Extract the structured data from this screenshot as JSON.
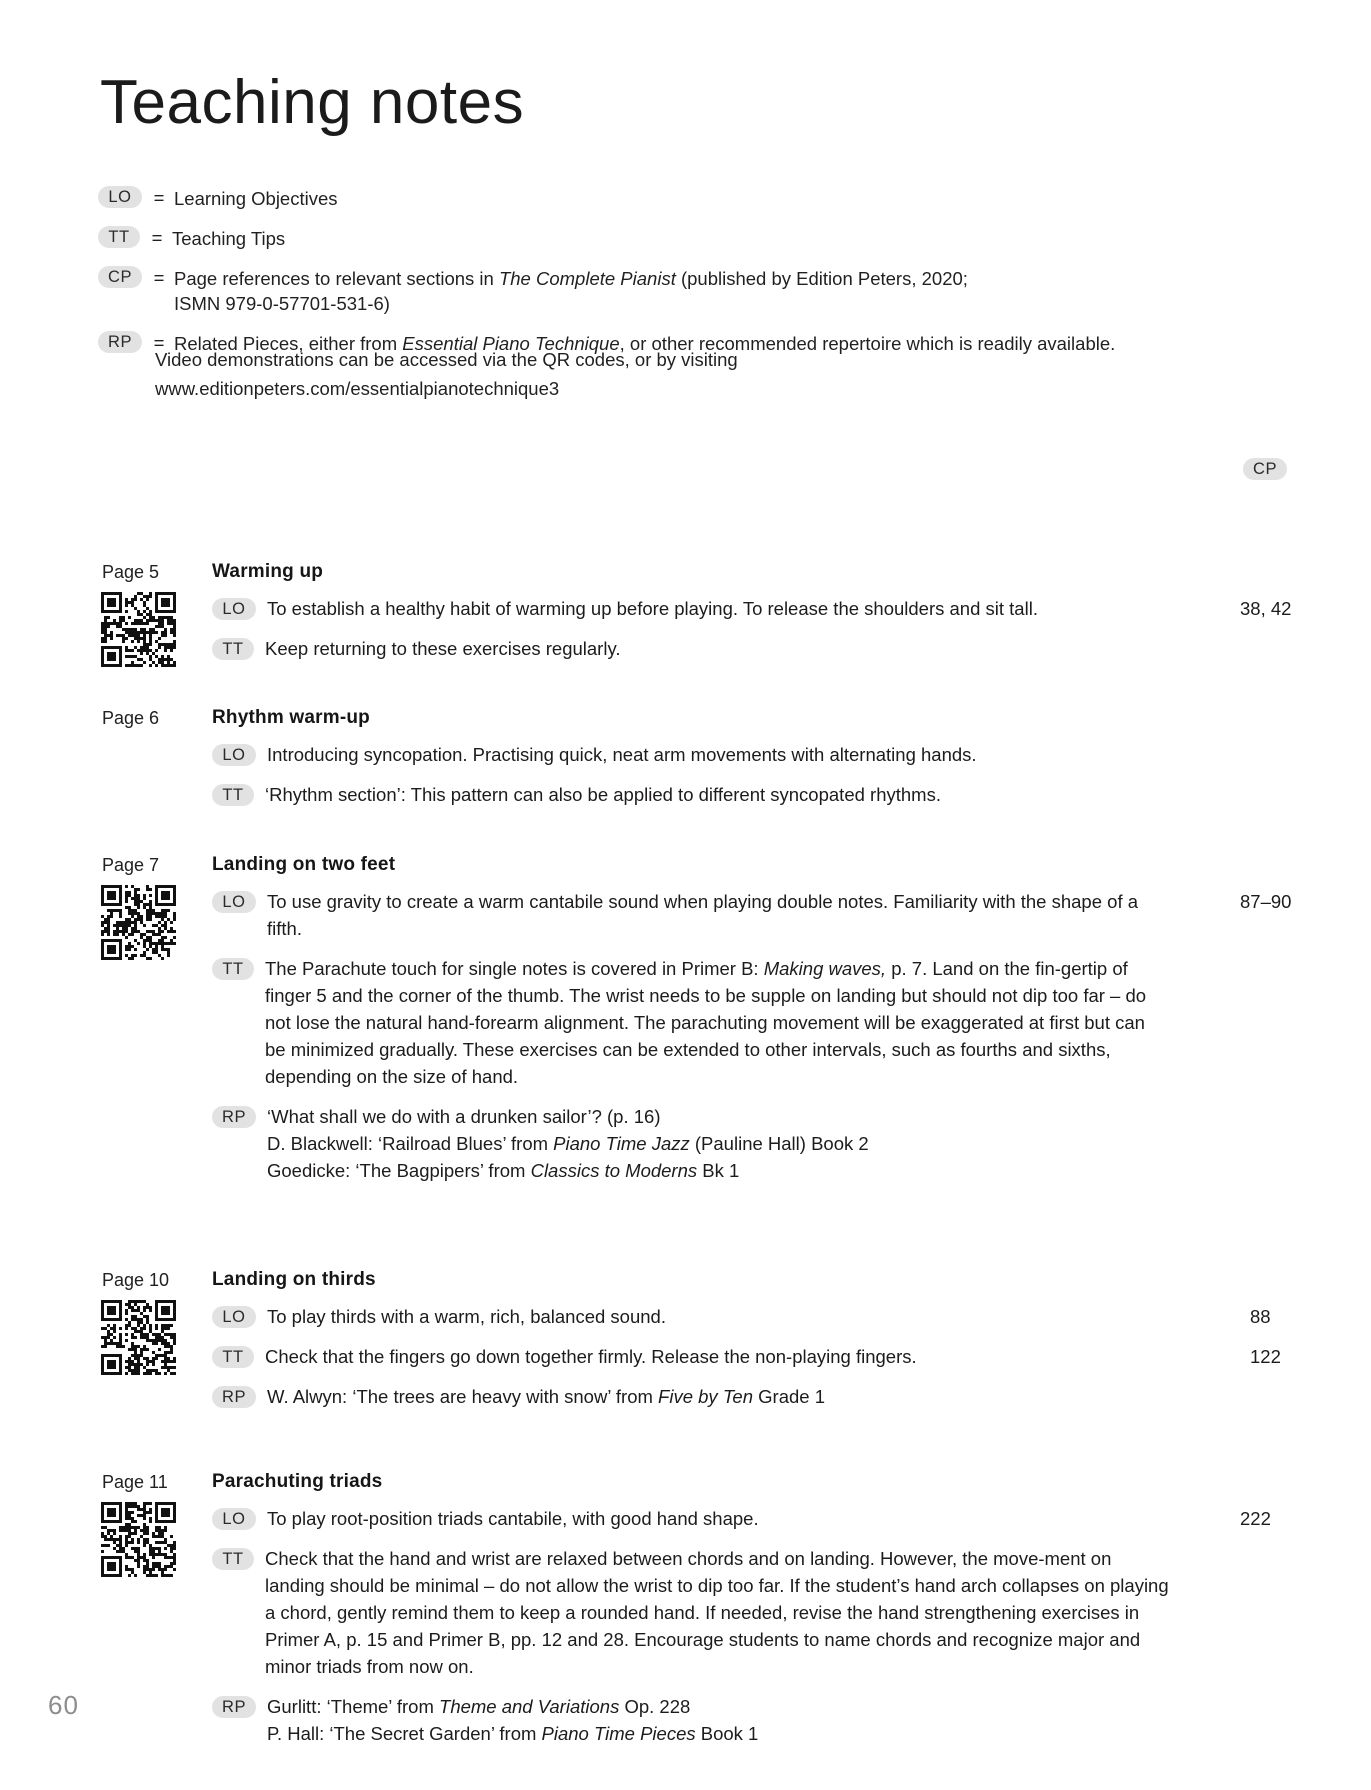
{
  "document": {
    "title": "Teaching notes",
    "folio": "60"
  },
  "legend": {
    "items": [
      {
        "tag": "LO",
        "eq": "=",
        "text": "Learning Objectives"
      },
      {
        "tag": "TT",
        "eq": "=",
        "text": "Teaching Tips"
      },
      {
        "tag": "CP",
        "eq": "=",
        "text_before": "Page references to relevant sections in ",
        "italic": "The Complete Pianist",
        "text_after": " (published by Edition Peters, 2020;",
        "line2": "ISMN 979-0-57701-531-6)"
      },
      {
        "tag": "RP",
        "eq": "=",
        "text_before": "Related Pieces, either from ",
        "italic": "Essential Piano Technique",
        "text_after": ", or other recommended repertoire which is readily available."
      }
    ],
    "note_line1": "Video demonstrations can be accessed via the QR codes, or by visiting",
    "note_line2": "www.editionpeters.com/essentialpianotechnique3"
  },
  "cp_column": {
    "header": "CP"
  },
  "entries": [
    {
      "page_ref": "Page 5",
      "title": "Warming up",
      "has_qr": true,
      "cp": "38, 42",
      "rows": [
        {
          "tag": "LO",
          "text": "To establish a healthy habit of warming up before playing. To release the shoulders and sit tall."
        },
        {
          "tag": "TT",
          "text": "Keep returning to these exercises regularly."
        }
      ]
    },
    {
      "page_ref": "Page 6",
      "title": "Rhythm warm-up",
      "has_qr": false,
      "cp": "",
      "rows": [
        {
          "tag": "LO",
          "text": "Introducing syncopation. Practising quick, neat arm movements with alternating hands."
        },
        {
          "tag": "TT",
          "text": "‘Rhythm section’: This pattern can also be applied to different syncopated rhythms."
        }
      ]
    },
    {
      "page_ref": "Page 7",
      "title": "Landing on two feet",
      "has_qr": true,
      "cp": "87–90",
      "rows": [
        {
          "tag": "LO",
          "text": "To use gravity to create a warm cantabile sound when playing double notes. Familiarity with the shape of a fifth."
        },
        {
          "tag": "TT",
          "text_parts": [
            {
              "t": "The Parachute touch for single notes is covered in Primer B: "
            },
            {
              "t": "Making waves,",
              "i": true
            },
            {
              "t": " p. 7. Land on the fin-gertip of finger 5 and the corner of the thumb. The wrist needs to be supple on landing but should not dip too far – do not lose the natural hand-forearm alignment. The parachuting movement will be exaggerated at first but can be minimized gradually. These exercises can be extended to other intervals, such as fourths and sixths, depending on the size of hand."
            }
          ]
        },
        {
          "tag": "RP",
          "lines": [
            [
              {
                "t": "‘What shall we do with a drunken sailor’? (p. 16)"
              }
            ],
            [
              {
                "t": "D. Blackwell: ‘Railroad Blues’ from "
              },
              {
                "t": "Piano Time Jazz",
                "i": true
              },
              {
                "t": " (Pauline Hall) Book 2"
              }
            ],
            [
              {
                "t": "Goedicke: ‘The Bagpipers’ from "
              },
              {
                "t": "Classics to Moderns",
                "i": true
              },
              {
                "t": " Bk 1"
              }
            ]
          ]
        }
      ]
    },
    {
      "page_ref": "Page 10",
      "title": "Landing on thirds",
      "has_qr": true,
      "cp_multi": [
        "88",
        "122"
      ],
      "rows": [
        {
          "tag": "LO",
          "text": "To play thirds with a warm, rich, balanced sound."
        },
        {
          "tag": "TT",
          "text": "Check that the fingers go down together firmly. Release the non-playing fingers."
        },
        {
          "tag": "RP",
          "lines": [
            [
              {
                "t": "W.  Alwyn: ‘The trees are heavy with snow’ from "
              },
              {
                "t": "Five by Ten",
                "i": true
              },
              {
                "t": " Grade 1"
              }
            ]
          ]
        }
      ]
    },
    {
      "page_ref": "Page 11",
      "title": "Parachuting triads",
      "has_qr": true,
      "cp": "222",
      "rows": [
        {
          "tag": "LO",
          "text": "To play root-position triads cantabile, with good hand shape."
        },
        {
          "tag": "TT",
          "text": "Check that the hand and wrist are relaxed between chords and on landing. However, the move-ment on landing should be minimal – do not allow the wrist to dip too far. If the student’s hand arch collapses on playing a chord, gently remind them to keep a rounded hand. If needed, revise the hand strengthening exercises in Primer A, p. 15 and Primer B, pp. 12 and 28. Encourage students to name chords and recognize major and minor triads from now on."
        },
        {
          "tag": "RP",
          "lines": [
            [
              {
                "t": "Gurlitt: ‘Theme’ from "
              },
              {
                "t": "Theme and Variations",
                "i": true
              },
              {
                "t": " Op. 228"
              }
            ],
            [
              {
                "t": "P. Hall: ‘The Secret Garden’ from "
              },
              {
                "t": "Piano Time Pieces",
                "i": true
              },
              {
                "t": " Book 1"
              }
            ]
          ]
        }
      ]
    }
  ]
}
